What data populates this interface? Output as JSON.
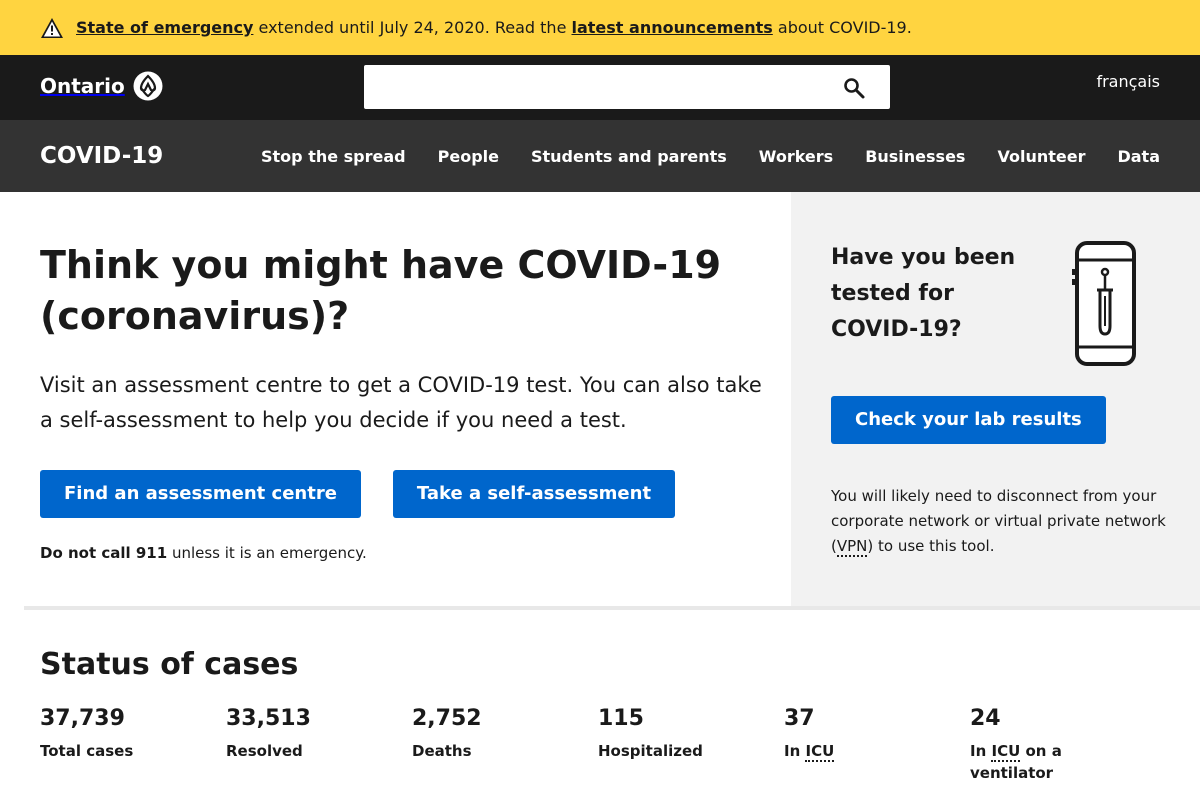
{
  "alert": {
    "link1": "State of emergency",
    "text1": " extended until July 24, 2020. Read the ",
    "link2": "latest announcements",
    "text2": " about COVID-19."
  },
  "header": {
    "logo_text": "Ontario",
    "search_placeholder": "",
    "search_value": "",
    "language_link": "français"
  },
  "subnav": {
    "site_title": "COVID-19",
    "links": [
      "Stop the spread",
      "People",
      "Students and parents",
      "Workers",
      "Businesses",
      "Volunteer",
      "Data"
    ]
  },
  "hero": {
    "title": "Think you might have COVID-19 (coronavirus)?",
    "description": "Visit an assessment centre to get a COVID-19 test. You can also take a self-assessment to help you decide if you need a test.",
    "button_find": "Find an assessment centre",
    "button_self": "Take a self-assessment",
    "warning_bold": "Do not call 911",
    "warning_rest": " unless it is an emergency."
  },
  "panel": {
    "title": "Have you been tested for COVID-19?",
    "button": "Check your lab results",
    "note_before": "You will likely need to disconnect from your corporate network or virtual private network (",
    "note_abbr": "VPN",
    "note_after": ") to use this tool."
  },
  "status": {
    "title": "Status of cases",
    "items": [
      {
        "value": "37,739",
        "label": "Total cases"
      },
      {
        "value": "33,513",
        "label": "Resolved"
      },
      {
        "value": "2,752",
        "label": "Deaths"
      },
      {
        "value": "115",
        "label": "Hospitalized"
      },
      {
        "value": "37",
        "label_pre": "In ",
        "label_abbr": "ICU",
        "label_post": ""
      },
      {
        "value": "24",
        "label_pre": "In ",
        "label_abbr": "ICU",
        "label_post": " on a ventilator"
      }
    ]
  },
  "colors": {
    "alert_bg": "#ffd440",
    "header_bg": "#1a1a1a",
    "subnav_bg": "#333333",
    "button_blue": "#0066cc",
    "panel_bg": "#f2f2f2"
  },
  "icons": {
    "alert": "warning-triangle-icon",
    "logo": "ontario-trillium-icon",
    "search": "search-icon",
    "illustration": "phone-test-swab-icon"
  }
}
